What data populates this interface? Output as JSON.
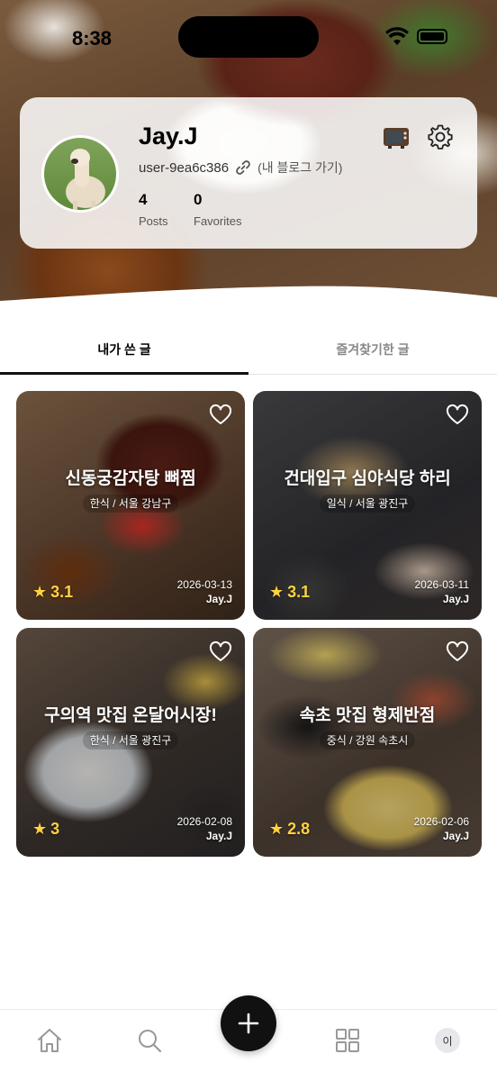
{
  "status_bar": {
    "time": "8:38"
  },
  "profile": {
    "name": "Jay.J",
    "handle": "user-9ea6c386",
    "blog_link": "(내 블로그 가기)",
    "stats": [
      {
        "value": "4",
        "label": "Posts"
      },
      {
        "value": "0",
        "label": "Favorites"
      }
    ]
  },
  "tabs": [
    {
      "label": "내가 쓴 글",
      "active": true
    },
    {
      "label": "즐겨찾기한 글",
      "active": false
    }
  ],
  "posts": [
    {
      "title": "신동궁감자탕 뼈찜",
      "category": "한식 / 서울 강남구",
      "rating": "3.1",
      "date": "2026-03-13",
      "author": "Jay.J"
    },
    {
      "title": "건대입구 심야식당 하리",
      "category": "일식 / 서울 광진구",
      "rating": "3.1",
      "date": "2026-03-11",
      "author": "Jay.J"
    },
    {
      "title": "구의역 맛집 온달어시장!",
      "category": "한식 / 서울 광진구",
      "rating": "3",
      "date": "2026-02-08",
      "author": "Jay.J"
    },
    {
      "title": "속초 맛집 형제반점",
      "category": "중식 / 강원 속초시",
      "rating": "2.8",
      "date": "2026-02-06",
      "author": "Jay.J"
    }
  ],
  "bottom_nav": {
    "items": [
      "home-icon",
      "search-icon",
      "add-icon",
      "grid-icon",
      "profile-avatar"
    ],
    "profile_initial": "이"
  },
  "colors": {
    "accent": "#111111",
    "rating": "#ffd23f"
  }
}
